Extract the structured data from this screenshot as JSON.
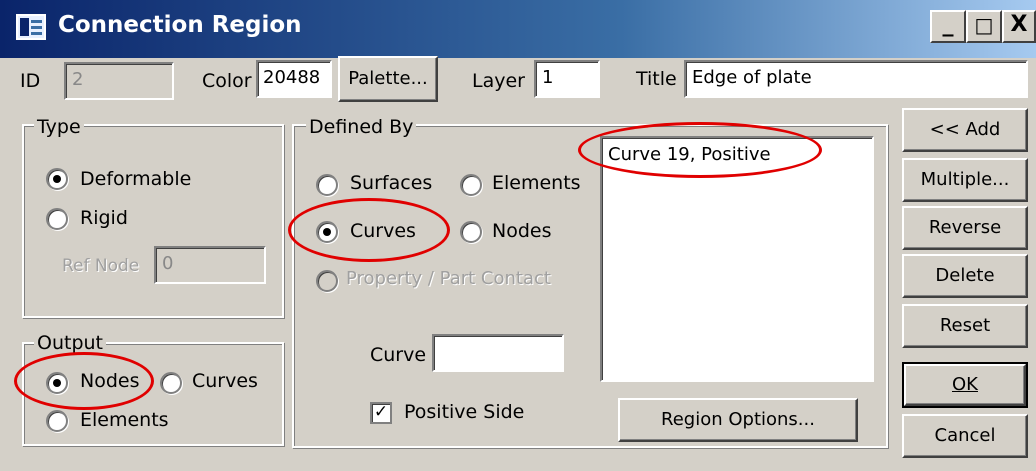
{
  "window": {
    "title": "Connection Region",
    "caption_buttons": {
      "minimize": "_",
      "maximize": "□",
      "close": "X"
    }
  },
  "header": {
    "id_label": "ID",
    "id_value": "2",
    "color_label": "Color",
    "color_value": "20488",
    "palette_button": "Palette...",
    "layer_label": "Layer",
    "layer_value": "1",
    "title_label": "Title",
    "title_value": "Edge of plate"
  },
  "type_group": {
    "legend": "Type",
    "options": [
      "Deformable",
      "Rigid"
    ],
    "selected": "Deformable",
    "ref_node_label": "Ref Node",
    "ref_node_value": "0"
  },
  "output_group": {
    "legend": "Output",
    "options": [
      "Nodes",
      "Curves",
      "Elements"
    ],
    "selected": "Nodes"
  },
  "defined_by_group": {
    "legend": "Defined By",
    "options": [
      "Surfaces",
      "Elements",
      "Curves",
      "Nodes",
      "Property / Part Contact"
    ],
    "selected": "Curves",
    "curve_label": "Curve",
    "curve_value": "",
    "positive_side_label": "Positive Side",
    "positive_side_checked": "✓",
    "region_list": [
      "Curve 19, Positive"
    ],
    "region_options_button": "Region Options..."
  },
  "actions": {
    "add": "<< Add",
    "multiple": "Multiple...",
    "reverse": "Reverse",
    "delete": "Delete",
    "reset": "Reset",
    "ok": "OK",
    "cancel": "Cancel"
  },
  "colors": {
    "titlebar_start": "#0a246a",
    "titlebar_end": "#a6caf0",
    "dialog_bg": "#d4d0c8",
    "annotation": "#e00000"
  }
}
